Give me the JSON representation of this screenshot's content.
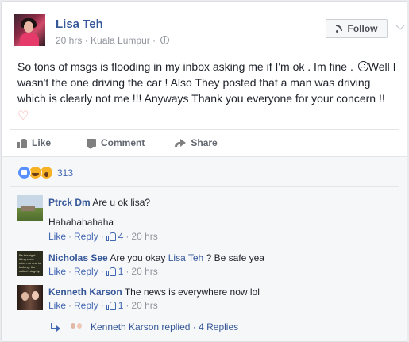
{
  "post": {
    "author": "Lisa Teh",
    "time": "20 hrs",
    "location": "Kuala Lumpur",
    "meta_sep": " · ",
    "follow_label": "Follow",
    "text_1": "So tons of msgs is flooding in my inbox asking me if I'm ok . Im fine . ",
    "text_2": "Well I wasn't the one driving the car ! Also They posted that a man was driving which is clearly not me !!! Anyways Thank you everyone for your concern !!",
    "heart": "♡"
  },
  "actions": {
    "like": "Like",
    "comment": "Comment",
    "share": "Share"
  },
  "reactions": {
    "count": "313",
    "types": [
      "like",
      "haha",
      "wow"
    ]
  },
  "comments": [
    {
      "name": "Ptrck Dm",
      "text": "Are u ok lisa?",
      "extra": "Hahahahahaha",
      "like": "Like",
      "reply": "Reply",
      "likes": "4",
      "time": "20 hrs"
    },
    {
      "name": "Nicholas See",
      "text": "Are you okay ",
      "mention": "Lisa Teh",
      "text_after": " ? Be safe yea",
      "like": "Like",
      "reply": "Reply",
      "likes": "1",
      "time": "20 hrs",
      "avatar_text": "Be the right thing even when no one is looking. It's called integrity."
    },
    {
      "name": "Kenneth Karson",
      "text": "The news is everywhere now lol",
      "like": "Like",
      "reply": "Reply",
      "likes": "1",
      "time": "20 hrs"
    }
  ],
  "reply_summary": {
    "name": "Kenneth Karson",
    "replied": "replied",
    "count": "4 Replies",
    "sep": " · "
  },
  "colors": {
    "link": "#365899",
    "action_link": "#4267b2",
    "meta": "#90949c",
    "like_reaction": "#5890ff",
    "emoji_reaction": "#f7b125"
  }
}
